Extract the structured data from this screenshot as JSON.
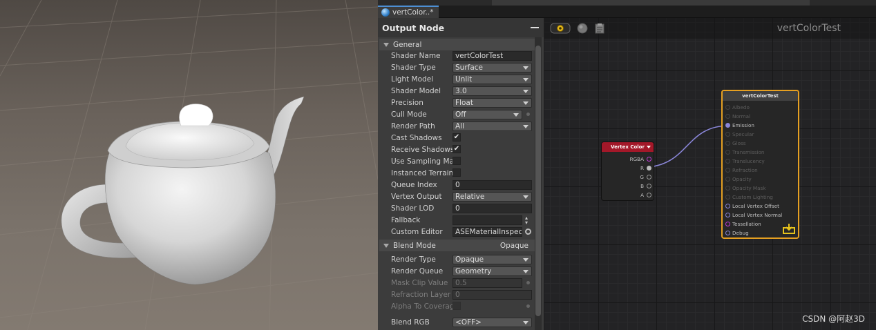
{
  "tab": {
    "label": "vertColor..*",
    "icon": "shader-sphere-icon"
  },
  "inspector": {
    "title": "Output Node",
    "sections": {
      "general": {
        "title": "General"
      },
      "blend": {
        "title": "Blend Mode",
        "value": "Opaque"
      }
    },
    "props": {
      "shader_name": {
        "label": "Shader Name",
        "value": "vertColorTest"
      },
      "shader_type": {
        "label": "Shader Type",
        "value": "Surface"
      },
      "light_model": {
        "label": "Light Model",
        "value": "Unlit"
      },
      "shader_model": {
        "label": "Shader Model",
        "value": "3.0"
      },
      "precision": {
        "label": "Precision",
        "value": "Float"
      },
      "cull_mode": {
        "label": "Cull Mode",
        "value": "Off"
      },
      "render_path": {
        "label": "Render Path",
        "value": "All"
      },
      "cast_shadows": {
        "label": "Cast Shadows",
        "value": "✔"
      },
      "receive_shadows": {
        "label": "Receive Shadows",
        "value": "✔"
      },
      "use_sampling": {
        "label": "Use Sampling Mac"
      },
      "instanced_terrain": {
        "label": "Instanced Terrain"
      },
      "queue_index": {
        "label": "Queue Index",
        "value": "0"
      },
      "vertex_output": {
        "label": "Vertex Output",
        "value": "Relative"
      },
      "shader_lod": {
        "label": "Shader LOD",
        "value": "0"
      },
      "fallback": {
        "label": "Fallback",
        "value": ""
      },
      "custom_editor": {
        "label": "Custom Editor",
        "value": "ASEMaterialInspecto"
      },
      "render_type": {
        "label": "Render Type",
        "value": "Opaque"
      },
      "render_queue": {
        "label": "Render Queue",
        "value": "Geometry"
      },
      "mask_clip": {
        "label": "Mask Clip Value",
        "value": "0.5"
      },
      "refraction_layer": {
        "label": "Refraction Layer",
        "value": "0"
      },
      "alpha_coverage": {
        "label": "Alpha To Coverage"
      },
      "blend_rgb": {
        "label": "Blend RGB",
        "value": "<OFF>"
      }
    }
  },
  "graph": {
    "title": "vertColorTest",
    "watermark": "CSDN @阿赵3D",
    "vertex_color_node": {
      "title": "Vertex Color",
      "ports": [
        "RGBA",
        "R",
        "G",
        "B",
        "A"
      ]
    },
    "output_node": {
      "title": "vertColorTest",
      "ports": [
        {
          "label": "Albedo",
          "active": false
        },
        {
          "label": "Normal",
          "active": false
        },
        {
          "label": "Emission",
          "active": true
        },
        {
          "label": "Specular",
          "active": false
        },
        {
          "label": "Gloss",
          "active": false
        },
        {
          "label": "Transmission",
          "active": false
        },
        {
          "label": "Translucency",
          "active": false
        },
        {
          "label": "Refraction",
          "active": false
        },
        {
          "label": "Opacity",
          "active": false
        },
        {
          "label": "Opacity Mask",
          "active": false
        },
        {
          "label": "Custom Lighting",
          "active": false
        },
        {
          "label": "Local Vertex Offset",
          "active": true
        },
        {
          "label": "Local Vertex Normal",
          "active": true
        },
        {
          "label": "Tessellation",
          "active": true
        },
        {
          "label": "Debug",
          "active": true
        }
      ]
    }
  },
  "colors": {
    "accent_blue": "#4d8fd4",
    "node_red": "#a31829",
    "output_border": "#e6a021",
    "wire": "#8a86d8"
  }
}
